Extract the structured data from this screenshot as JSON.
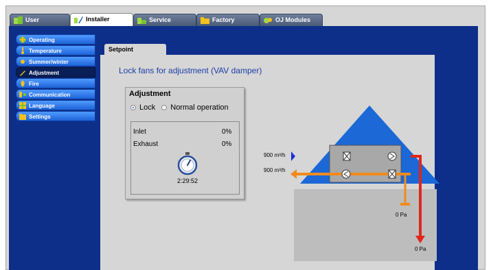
{
  "top_tabs": [
    {
      "label": "User",
      "icon": "user-icon",
      "active": false
    },
    {
      "label": "Installer",
      "icon": "installer-icon",
      "active": true
    },
    {
      "label": "Service",
      "icon": "service-icon",
      "active": false
    },
    {
      "label": "Factory",
      "icon": "factory-icon",
      "active": false
    },
    {
      "label": "OJ Modules",
      "icon": "modules-icon",
      "active": false
    }
  ],
  "sidebar": {
    "items": [
      {
        "label": "Operating",
        "icon": "operating-icon"
      },
      {
        "label": "Temperature",
        "icon": "temperature-icon"
      },
      {
        "label": "Summer/winter",
        "icon": "sun-icon"
      },
      {
        "label": "Adjustment",
        "icon": "wrench-icon",
        "active": true
      },
      {
        "label": "Fire",
        "icon": "fire-icon"
      },
      {
        "label": "Communication",
        "icon": "communication-icon"
      },
      {
        "label": "Language",
        "icon": "language-icon"
      },
      {
        "label": "Settings",
        "icon": "folder-icon"
      }
    ]
  },
  "content": {
    "tab_label": "Setpoint",
    "heading": "Lock fans for adjustment (VAV damper)"
  },
  "adjustment": {
    "title": "Adjustment",
    "lock_label": "Lock",
    "normal_label": "Normal operation",
    "selected": "Lock",
    "inlet_label": "Inlet",
    "inlet_value": "0%",
    "exhaust_label": "Exhaust",
    "exhaust_value": "0%",
    "timer": "2:29:52",
    "timer_icon": "stopwatch-icon"
  },
  "diagram": {
    "supply_flow": "900 m³/h",
    "exhaust_flow": "900 m³/h",
    "pressure_extract": "0 Pa",
    "pressure_supply": "0 Pa"
  },
  "colors": {
    "band": "#0d2f8a",
    "menu": "#2a7bef",
    "roof": "#1b68d6",
    "building": "#bdbdbd",
    "supply": "#e0261b",
    "exhaust": "#f28a1c",
    "intake": "#1a2fd6"
  }
}
